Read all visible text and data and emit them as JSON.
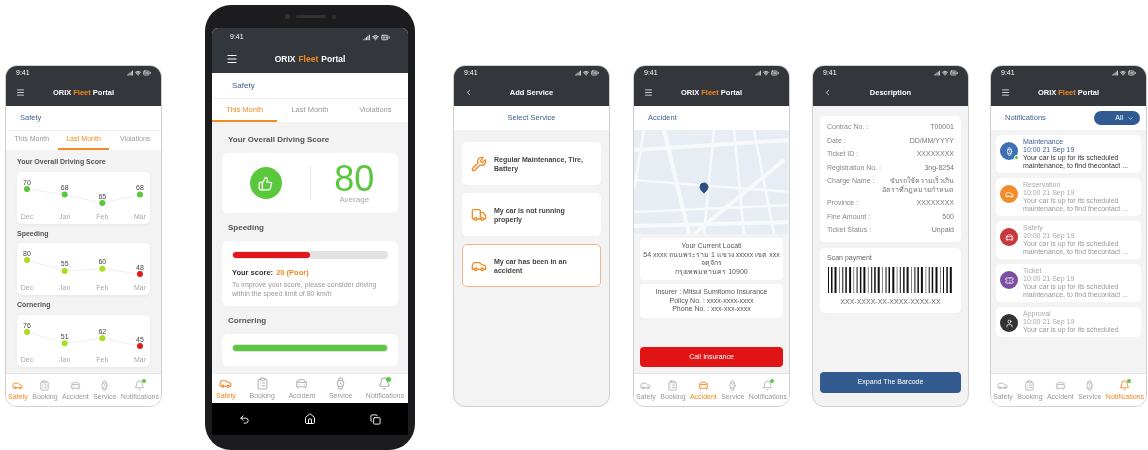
{
  "screens": [
    {
      "kind": "safety_trend",
      "time": "9:41",
      "header": {
        "kind": "home",
        "title": [
          {
            "text": "ORIX",
            "accent": false
          },
          {
            "text": "Fleet",
            "accent": true
          },
          {
            "text": "Portal",
            "accent": false
          }
        ]
      },
      "section": "Safety",
      "tabs": [
        {
          "label": "This Month",
          "selected": false
        },
        {
          "label": "Last Month",
          "selected": true
        },
        {
          "label": "Violations",
          "selected": false
        }
      ],
      "cards": [
        {
          "title": "Your Overall Driving Score",
          "chart_data": {
            "type": "line",
            "categories": [
              "Dec",
              "Jan",
              "Feb",
              "Mar"
            ],
            "data_labels": true,
            "series": [
              {
                "color": "#5ac83c",
                "marker": "circle",
                "values": [
                  70,
                  68,
                  65,
                  68
                ]
              }
            ]
          }
        },
        {
          "title": "Speeding",
          "chart_data": {
            "type": "line",
            "categories": [
              "Dec",
              "Jan",
              "Feb",
              "Mar"
            ],
            "data_labels": true,
            "series": [
              {
                "color": "#a6df22",
                "marker": "circle",
                "values": [
                  80,
                  55,
                  60,
                  48
                ]
              }
            ]
          }
        },
        {
          "title": "Cornering",
          "chart_data": {
            "type": "line",
            "categories": [
              "Dec",
              "Jan",
              "Feb",
              "Mar"
            ],
            "data_labels": true,
            "series": [
              {
                "color": "#a6df22",
                "marker": "circle",
                "values": [
                  76,
                  51,
                  62,
                  45
                ]
              }
            ]
          }
        }
      ],
      "nav": [
        {
          "label": "Safety",
          "kind": "safety",
          "selected": true,
          "badge": false
        },
        {
          "label": "Booking",
          "kind": "booking",
          "selected": false,
          "badge": false
        },
        {
          "label": "Accident",
          "kind": "accident",
          "selected": false,
          "badge": false
        },
        {
          "label": "Service",
          "kind": "service",
          "selected": false,
          "badge": false
        },
        {
          "label": "Notifications",
          "kind": "notifications",
          "selected": false,
          "badge": true
        }
      ]
    },
    {
      "kind": "safety_score",
      "time": "9:41",
      "header": {
        "kind": "home",
        "title": [
          {
            "text": "ORIX",
            "accent": false
          },
          {
            "text": "Fleet",
            "accent": true
          },
          {
            "text": "Portal",
            "accent": false
          }
        ]
      },
      "section": "Safety",
      "tabs": [
        {
          "label": "This Month",
          "selected": true
        },
        {
          "label": "Last Month",
          "selected": false
        },
        {
          "label": "Violations",
          "selected": false
        }
      ],
      "score_title": "Your Overall Driving Score",
      "score": "80",
      "score_label": "Average",
      "bars": [
        {
          "title": "Speeding",
          "level": 0.5,
          "color": "#e3161b",
          "score_label": "Your score:",
          "score_value": "20 (Poor)",
          "hint": "To improve your score, please consider driving within the speed limit of 80 km/h"
        },
        {
          "title": "Cornering",
          "level": 1,
          "color": "#5ac83c"
        }
      ],
      "nav": [
        {
          "label": "Safety",
          "kind": "safety",
          "selected": true,
          "badge": false
        },
        {
          "label": "Booking",
          "kind": "booking",
          "selected": false,
          "badge": false
        },
        {
          "label": "Accident",
          "kind": "accident",
          "selected": false,
          "badge": false
        },
        {
          "label": "Service",
          "kind": "service",
          "selected": false,
          "badge": false
        },
        {
          "label": "Notifications",
          "kind": "notifications",
          "selected": false,
          "badge": true
        }
      ]
    },
    {
      "kind": "add_service",
      "time": "9:41",
      "header": {
        "kind": "subpage",
        "title": [
          {
            "text": "Add Service",
            "accent": false
          }
        ]
      },
      "section": "Select Service",
      "services": [
        {
          "label": "Regular Maintenance, Tire, Battery",
          "kind": "tools",
          "selected": false
        },
        {
          "label": "My car is not running properly",
          "kind": "tow_truck",
          "selected": false
        },
        {
          "label": "My car has been in an accident",
          "kind": "crash",
          "selected": true
        }
      ]
    },
    {
      "kind": "accident",
      "time": "9:41",
      "header": {
        "kind": "home",
        "title": [
          {
            "text": "ORIX",
            "accent": false
          },
          {
            "text": "Fleet",
            "accent": true
          },
          {
            "text": "Portal",
            "accent": false
          }
        ]
      },
      "section": "Accident",
      "location": [
        "Your Current Locati",
        "54 xxxx ถนนพระราม 1 แขวง xxxxx เขต xxx จตุจักร",
        "กรุงเทพมหานคร 10900"
      ],
      "insurer": [
        "Insurer : Mitsui Sumitomo Insurance",
        "Policy No. : xxxx-xxxx-xxxx",
        "Phone No. : xxx-xxx-xxxx"
      ],
      "button": "Call Insurance",
      "nav": [
        {
          "label": "Safety",
          "kind": "safety",
          "selected": false,
          "badge": false
        },
        {
          "label": "Booking",
          "kind": "booking",
          "selected": false,
          "badge": false
        },
        {
          "label": "Accident",
          "kind": "accident",
          "selected": true,
          "badge": false
        },
        {
          "label": "Service",
          "kind": "service",
          "selected": false,
          "badge": false
        },
        {
          "label": "Notifications",
          "kind": "notifications",
          "selected": false,
          "badge": true
        }
      ]
    },
    {
      "kind": "description",
      "time": "9:41",
      "header": {
        "kind": "subpage",
        "title": [
          {
            "text": "Description",
            "accent": false
          }
        ]
      },
      "fields": [
        {
          "label": "Contrac No. :",
          "value": "T00001"
        },
        {
          "label": "Date :",
          "value": "DD/MM/YYYY"
        },
        {
          "label": "Ticket ID :",
          "value": "XXXXXXXX"
        },
        {
          "label": "Registration No. :",
          "value": "3ng-8254"
        },
        {
          "label": "Charge Name :",
          "value": "ขับรถใช้ความเร็วเกิน อัตราที่กฎหมายกำหนด"
        },
        {
          "label": "Province :",
          "value": "XXXXXXXX"
        },
        {
          "label": "Fine Amount :",
          "value": "500"
        },
        {
          "label": "Ticket Status :",
          "value": "Unpaid"
        }
      ],
      "payment": {
        "title": "Scan payment",
        "code": "XXX-XXXX-XX-XXXX-XXXX-XX"
      },
      "button": "Expand The Barcode"
    },
    {
      "kind": "notifications",
      "time": "9:41",
      "header": {
        "kind": "home",
        "title": [
          {
            "text": "ORIX",
            "accent": false
          },
          {
            "text": "Fleet",
            "accent": true
          },
          {
            "text": "Portal",
            "accent": false
          }
        ]
      },
      "section": "Notifications",
      "filter": "All",
      "items": [
        {
          "title": "Maintenance",
          "time": "10:00 21 Sep 19",
          "body": "Your car is up for its scheduled maintenance, to find thecontact ...",
          "kind": "watch",
          "color": "#3f6fb5",
          "unread": true,
          "online": true
        },
        {
          "title": "Reservation",
          "time": "10:00 21 Sep 19",
          "body": "Your car is up for its scheduled maintenance, to find thecontact ...",
          "kind": "car",
          "color": "#f28c2a",
          "unread": false,
          "online": false
        },
        {
          "title": "Safety",
          "time": "10:00 21 Sep 19",
          "body": "Your car is up for its scheduled maintenance, to find thecontact ...",
          "kind": "safety",
          "color": "#c8373b",
          "unread": false,
          "online": false
        },
        {
          "title": "Ticket",
          "time": "10:00 21 Sep 19",
          "body": "Your car is up for its scheduled maintenance, to find thecontact ...",
          "kind": "ticket",
          "color": "#7d4fa3",
          "unread": false,
          "online": false
        },
        {
          "title": "Approval",
          "time": "10:00 21 Sep 19",
          "body": "Your car is up for its scheduled",
          "kind": "person",
          "color": "#333333",
          "unread": false,
          "online": false
        }
      ],
      "nav": [
        {
          "label": "Safety",
          "kind": "safety",
          "selected": false,
          "badge": false
        },
        {
          "label": "Booking",
          "kind": "booking",
          "selected": false,
          "badge": false
        },
        {
          "label": "Accident",
          "kind": "accident",
          "selected": false,
          "badge": false
        },
        {
          "label": "Service",
          "kind": "service",
          "selected": false,
          "badge": false
        },
        {
          "label": "Notifications",
          "kind": "notifications",
          "selected": true,
          "badge": true
        }
      ]
    }
  ]
}
